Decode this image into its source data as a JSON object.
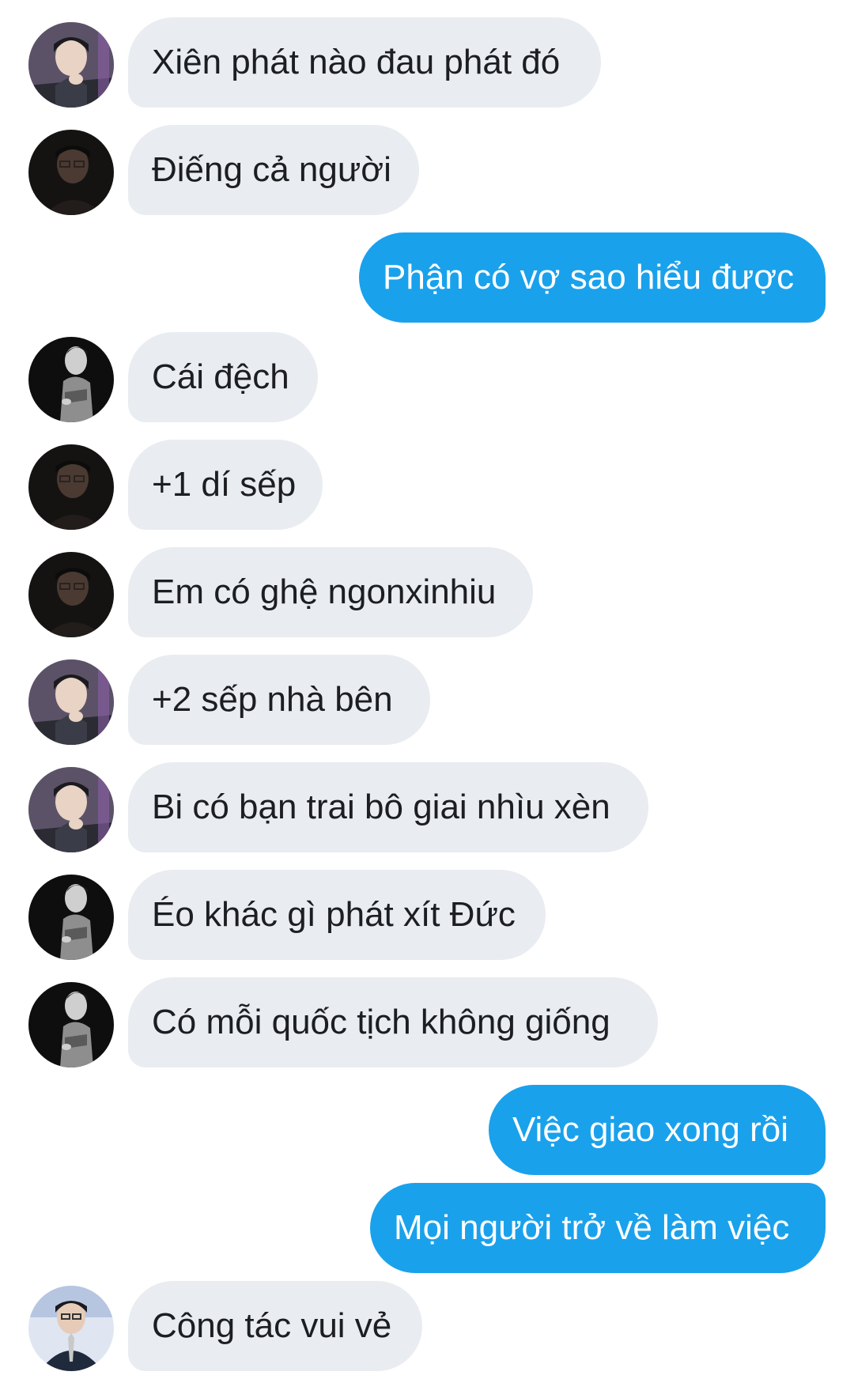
{
  "colors": {
    "incoming_bubble": "#e9ecf0",
    "outgoing_bubble": "#1aa1ec",
    "incoming_text": "#1c1e21",
    "outgoing_text": "#ffffff"
  },
  "messages": [
    {
      "side": "in",
      "avatar": "avatar-man-hand-chin",
      "text": "Xiên phát nào đau phát đó"
    },
    {
      "side": "in",
      "avatar": "avatar-man-glasses-dark",
      "text": "Điếng cả người"
    },
    {
      "side": "out",
      "text": "Phận có vợ sao hiểu được"
    },
    {
      "side": "in",
      "avatar": "avatar-man-bw-profile",
      "text": "Cái đệch"
    },
    {
      "side": "in",
      "avatar": "avatar-man-glasses-dark",
      "text": "+1 dí sếp"
    },
    {
      "side": "in",
      "avatar": "avatar-man-glasses-dark",
      "text": "Em có ghệ ngonxinhiu"
    },
    {
      "side": "in",
      "avatar": "avatar-man-hand-chin",
      "text": "+2 sếp nhà bên"
    },
    {
      "side": "in",
      "avatar": "avatar-man-hand-chin",
      "text": "Bi có bạn trai bô giai nhìu xèn"
    },
    {
      "side": "in",
      "avatar": "avatar-man-bw-profile",
      "text": "Éo khác gì phát xít Đức"
    },
    {
      "side": "in",
      "avatar": "avatar-man-bw-profile",
      "text": "Có mỗi quốc tịch không giống"
    },
    {
      "side": "out",
      "text": "Việc giao xong rồi"
    },
    {
      "side": "out",
      "text": "Mọi người trở về làm việc"
    },
    {
      "side": "in",
      "avatar": "avatar-man-suit-blue",
      "text": "Công tác vui vẻ"
    }
  ]
}
